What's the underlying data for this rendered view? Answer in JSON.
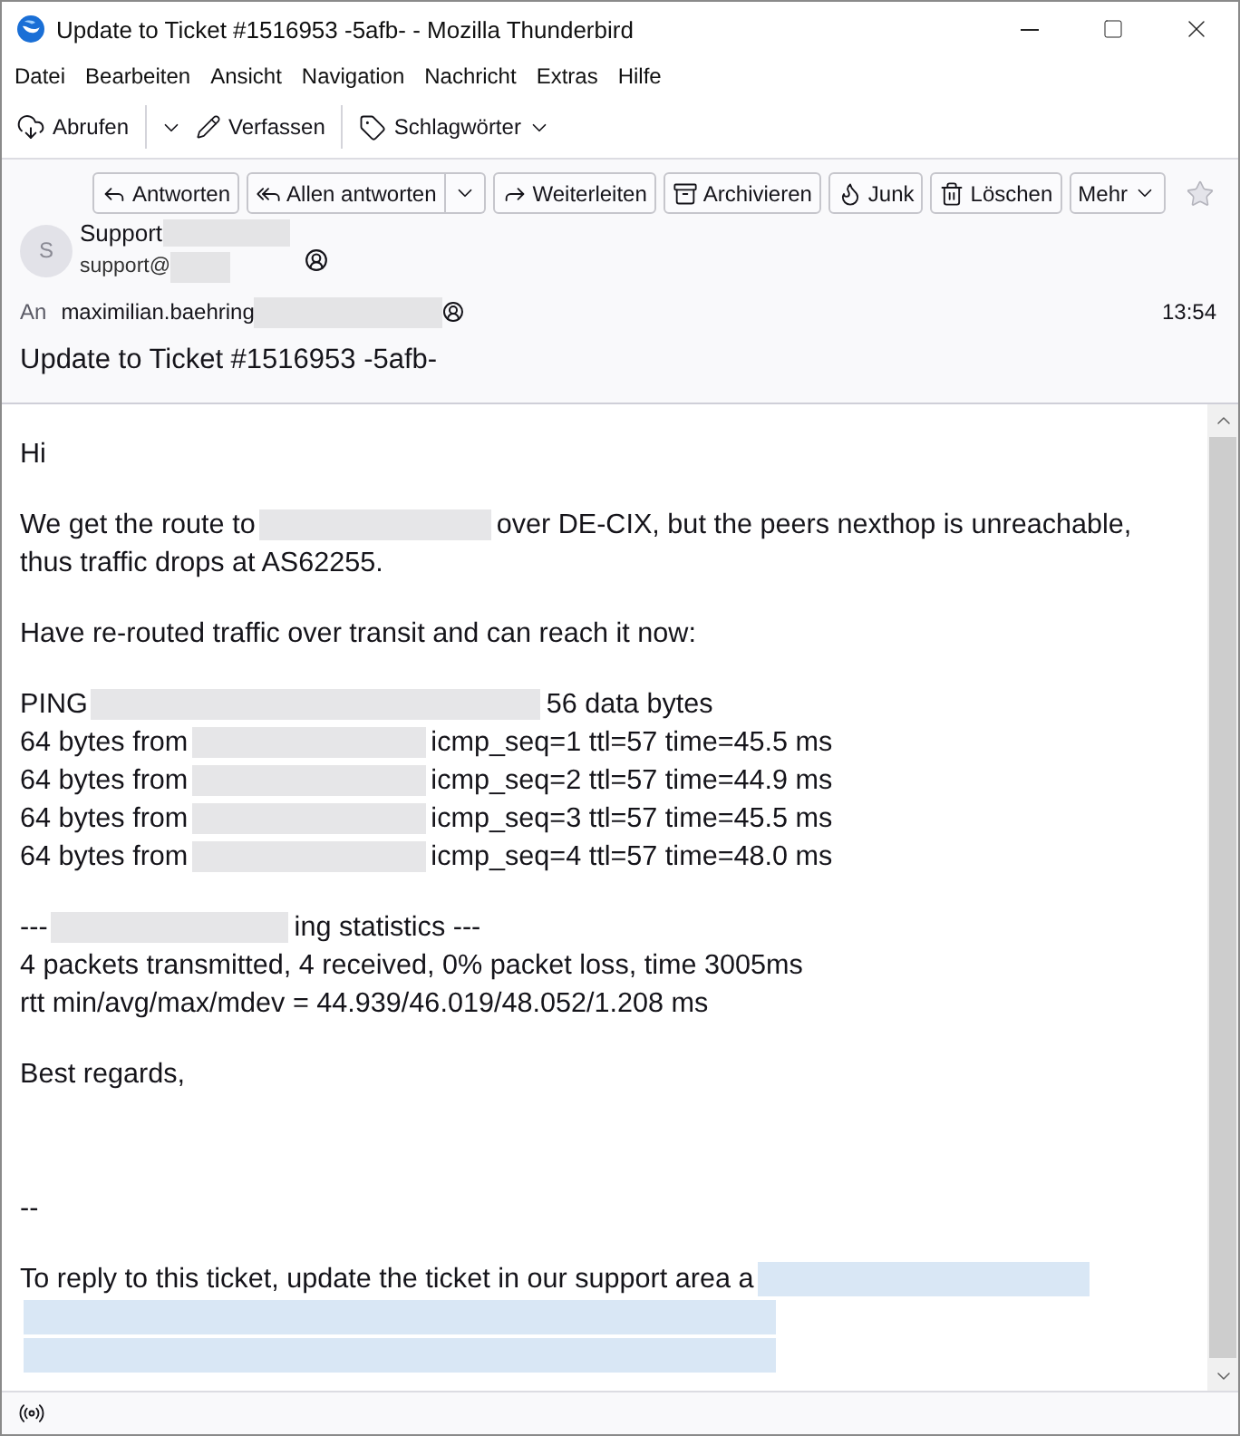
{
  "window": {
    "title": "Update to Ticket #1516953 -5afb- - Mozilla Thunderbird"
  },
  "menu": [
    "Datei",
    "Bearbeiten",
    "Ansicht",
    "Navigation",
    "Nachricht",
    "Extras",
    "Hilfe"
  ],
  "toolbar": [
    {
      "kind": "split",
      "label": "Abrufen"
    },
    {
      "kind": "button",
      "label": "Verfassen"
    },
    {
      "kind": "menu",
      "label": "Schlagwörter"
    }
  ],
  "actions": [
    {
      "kind": "button",
      "label": "Antworten"
    },
    {
      "kind": "split",
      "label": "Allen antworten"
    },
    {
      "kind": "button",
      "label": "Weiterleiten"
    },
    {
      "kind": "button",
      "label": "Archivieren"
    },
    {
      "kind": "button",
      "label": "Junk"
    },
    {
      "kind": "button",
      "label": "Löschen"
    },
    {
      "kind": "menu",
      "label": "Mehr"
    }
  ],
  "starred": false,
  "sender": {
    "initial": "S",
    "name": "Support",
    "email": "support@",
    "redacted": true
  },
  "recipient": {
    "label": "An",
    "address": "maximilian.baehring",
    "redacted": true
  },
  "time": "13:54",
  "subject": "Update to Ticket #1516953 -5afb-",
  "body": {
    "paragraphs": [
      {
        "kind": "text",
        "lines": [
          [
            {
              "kind": "text",
              "text": "Hi"
            }
          ]
        ]
      },
      {
        "kind": "text",
        "lines": [
          [
            {
              "kind": "text",
              "text": "We get the route to"
            },
            {
              "kind": "redacted"
            },
            {
              "kind": "text",
              "text": "over DE-CIX, but the peers nexthop is unreachable,"
            }
          ],
          [
            {
              "kind": "text",
              "text": "thus traffic drops at AS62255."
            }
          ]
        ]
      },
      {
        "kind": "text",
        "lines": [
          [
            {
              "kind": "text",
              "text": "Have re-routed traffic over transit and can reach it now:"
            }
          ]
        ]
      },
      {
        "kind": "text",
        "lines": [
          [
            {
              "kind": "text",
              "text": "PING"
            },
            {
              "kind": "redacted"
            },
            {
              "kind": "text",
              "text": "56 data bytes"
            }
          ],
          [
            {
              "kind": "text",
              "text": "64 bytes from"
            },
            {
              "kind": "redacted"
            },
            {
              "kind": "text",
              "text": "icmp_seq=1 ttl=57 time=45.5 ms"
            }
          ],
          [
            {
              "kind": "text",
              "text": "64 bytes from"
            },
            {
              "kind": "redacted"
            },
            {
              "kind": "text",
              "text": "icmp_seq=2 ttl=57 time=44.9 ms"
            }
          ],
          [
            {
              "kind": "text",
              "text": "64 bytes from"
            },
            {
              "kind": "redacted"
            },
            {
              "kind": "text",
              "text": "icmp_seq=3 ttl=57 time=45.5 ms"
            }
          ],
          [
            {
              "kind": "text",
              "text": "64 bytes from"
            },
            {
              "kind": "redacted"
            },
            {
              "kind": "text",
              "text": "icmp_seq=4 ttl=57 time=48.0 ms"
            }
          ]
        ]
      },
      {
        "kind": "text",
        "lines": [
          [
            {
              "kind": "text",
              "text": "---"
            },
            {
              "kind": "redacted"
            },
            {
              "kind": "text",
              "text": "ing statistics ---"
            }
          ],
          [
            {
              "kind": "text",
              "text": "4 packets transmitted, 4 received, 0% packet loss, time 3005ms"
            }
          ],
          [
            {
              "kind": "text",
              "text": "rtt min/avg/max/mdev = 44.939/46.019/48.052/1.208 ms"
            }
          ]
        ]
      },
      {
        "kind": "text",
        "lines": [
          [
            {
              "kind": "text",
              "text": "Best regards,"
            }
          ]
        ]
      },
      {
        "kind": "signature",
        "lines": [
          [
            {
              "kind": "text",
              "text": "--"
            }
          ]
        ]
      },
      {
        "kind": "text",
        "lines": [
          [
            {
              "kind": "text",
              "text": "To reply to this ticket, update the ticket in our support area a"
            },
            {
              "kind": "redacted_link"
            }
          ],
          [
            {
              "kind": "redacted_link"
            }
          ],
          [
            {
              "kind": "redacted_link"
            }
          ]
        ]
      }
    ]
  }
}
